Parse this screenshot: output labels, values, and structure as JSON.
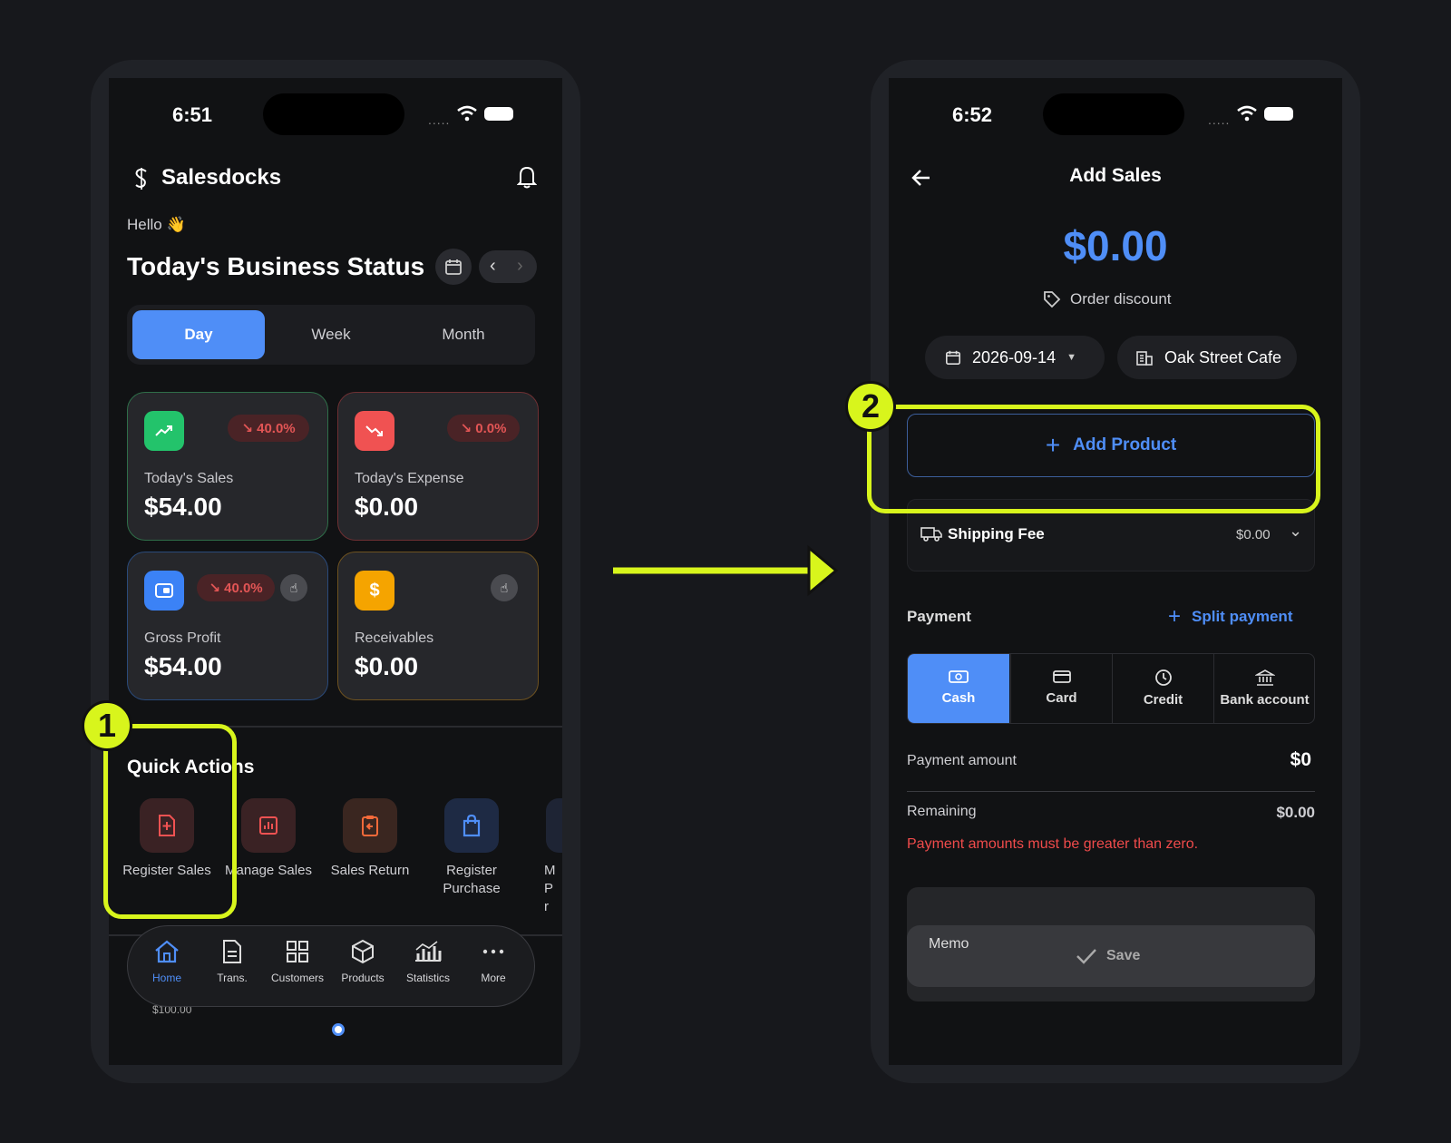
{
  "left": {
    "status": {
      "time": "6:51",
      "signal": "....."
    },
    "header": {
      "app_name": "Salesdocks"
    },
    "greeting": "Hello 👋",
    "section_title": "Today's Business Status",
    "period_tabs": [
      "Day",
      "Week",
      "Month"
    ],
    "cards": {
      "sales": {
        "label": "Today's Sales",
        "value": "$54.00",
        "change": "↘ 40.0%"
      },
      "expense": {
        "label": "Today's Expense",
        "value": "$0.00",
        "change": "↘ 0.0%"
      },
      "profit": {
        "label": "Gross Profit",
        "value": "$54.00",
        "change": "↘ 40.0%"
      },
      "receivables": {
        "label": "Receivables",
        "value": "$0.00"
      }
    },
    "quick_actions": {
      "title": "Quick Actions",
      "items": [
        "Register Sales",
        "Manage Sales",
        "Sales Return",
        "Register Purchase",
        "M Pr"
      ]
    },
    "bottom_nav": [
      "Home",
      "Trans.",
      "Customers",
      "Products",
      "Statistics",
      "More"
    ],
    "chart_peek": "$100.00"
  },
  "right": {
    "status": {
      "time": "6:52",
      "signal": "....."
    },
    "header": {
      "title": "Add Sales"
    },
    "total": "$0.00",
    "order_discount": "Order discount",
    "date": "2026-09-14",
    "store": "Oak Street Cafe",
    "add_product": "Add Product",
    "shipping": {
      "label": "Shipping Fee",
      "value": "$0.00"
    },
    "payment": {
      "title": "Payment",
      "split": "Split payment",
      "methods": [
        "Cash",
        "Card",
        "Credit",
        "Bank account"
      ],
      "amount_label": "Payment amount",
      "amount_value": "$0",
      "remaining_label": "Remaining",
      "remaining_value": "$0.00",
      "error": "Payment amounts must be greater than zero."
    },
    "memo": "Memo",
    "save": "Save"
  },
  "annotations": {
    "step1": "1",
    "step2": "2"
  },
  "colors": {
    "accent": "#4f8ef7",
    "highlight": "#d8f51c",
    "error": "#f04b4b",
    "green": "#23c36b",
    "red": "#f05252",
    "blue": "#3b82f6",
    "orange": "#f5a400"
  }
}
